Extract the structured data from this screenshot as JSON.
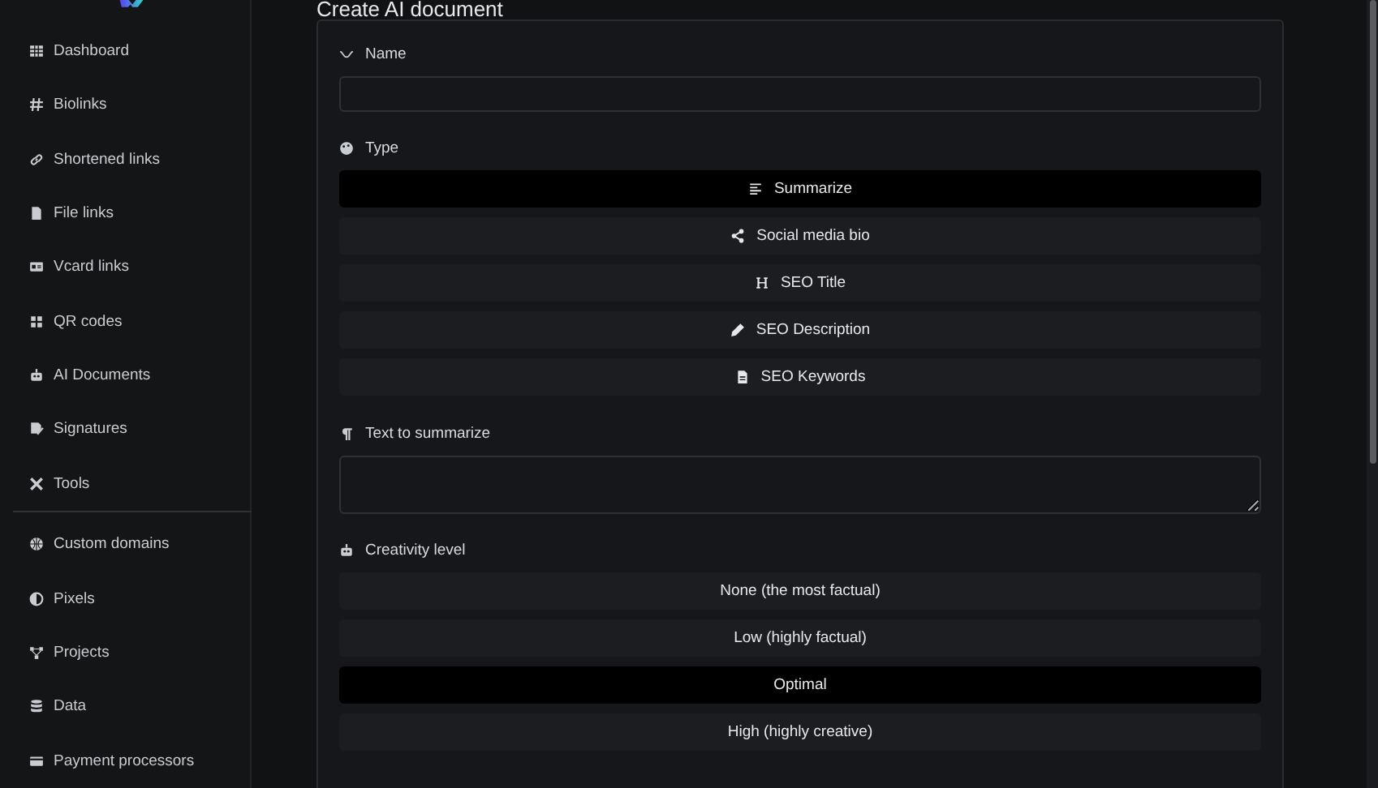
{
  "sidebar": {
    "sections": [
      {
        "items": [
          {
            "label": "Dashboard"
          },
          {
            "label": "Biolinks"
          },
          {
            "label": "Shortened links"
          },
          {
            "label": "File links"
          },
          {
            "label": "Vcard links"
          },
          {
            "label": "QR codes"
          },
          {
            "label": "AI Documents"
          },
          {
            "label": "Signatures"
          },
          {
            "label": "Tools"
          }
        ]
      },
      {
        "items": [
          {
            "label": "Custom domains"
          },
          {
            "label": "Pixels"
          },
          {
            "label": "Projects"
          },
          {
            "label": "Data"
          },
          {
            "label": "Payment processors"
          }
        ]
      }
    ]
  },
  "page": {
    "title": "Create AI document"
  },
  "form": {
    "name": {
      "label": "Name"
    },
    "type": {
      "label": "Type",
      "options": [
        {
          "label": "Summarize",
          "selected": true
        },
        {
          "label": "Social media bio",
          "selected": false
        },
        {
          "label": "SEO Title",
          "selected": false
        },
        {
          "label": "SEO Description",
          "selected": false
        },
        {
          "label": "SEO Keywords",
          "selected": false
        }
      ]
    },
    "text": {
      "label": "Text to summarize"
    },
    "creativity": {
      "label": "Creativity level",
      "options": [
        {
          "label": "None (the most factual)",
          "selected": false
        },
        {
          "label": "Low (highly factual)",
          "selected": false
        },
        {
          "label": "Optimal",
          "selected": true
        },
        {
          "label": "High (highly creative)",
          "selected": false
        }
      ]
    }
  }
}
